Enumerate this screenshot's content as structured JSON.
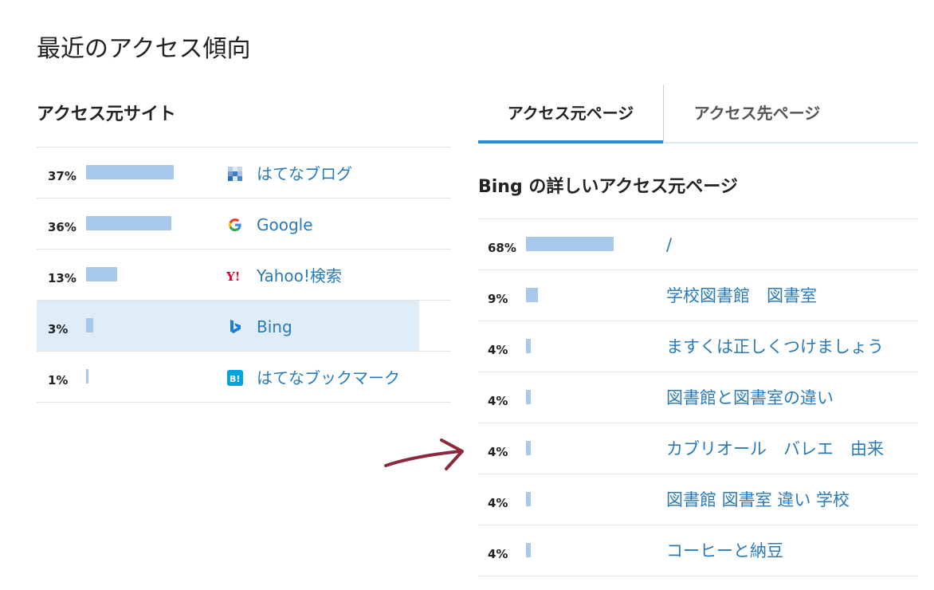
{
  "page": {
    "title": "最近のアクセス傾向"
  },
  "referrers": {
    "heading": "アクセス元サイト",
    "rows": [
      {
        "percent": "37%",
        "share": 0.37,
        "name": "はてなブログ",
        "icon": "hatena-blog-icon"
      },
      {
        "percent": "36%",
        "share": 0.36,
        "name": "Google",
        "icon": "google-icon"
      },
      {
        "percent": "13%",
        "share": 0.13,
        "name": "Yahoo!検索",
        "icon": "yahoo-icon"
      },
      {
        "percent": "3%",
        "share": 0.03,
        "name": "Bing",
        "icon": "bing-icon",
        "selected": true
      },
      {
        "percent": "1%",
        "share": 0.01,
        "name": "はてなブックマーク",
        "icon": "hatena-bookmark-icon"
      }
    ]
  },
  "detail": {
    "tabs": [
      {
        "label": "アクセス元ページ",
        "active": true
      },
      {
        "label": "アクセス先ページ",
        "active": false
      }
    ],
    "heading": "Bing の詳しいアクセス元ページ",
    "rows": [
      {
        "percent": "68%",
        "share": 0.68,
        "page": "/"
      },
      {
        "percent": "9%",
        "share": 0.09,
        "page": "学校図書館　図書室"
      },
      {
        "percent": "4%",
        "share": 0.04,
        "page": "ますくは正しくつけましょう"
      },
      {
        "percent": "4%",
        "share": 0.04,
        "page": "図書館と図書室の違い"
      },
      {
        "percent": "4%",
        "share": 0.04,
        "page": "カブリオール　バレエ　由来"
      },
      {
        "percent": "4%",
        "share": 0.04,
        "page": "図書館 図書室 違い 学校"
      },
      {
        "percent": "4%",
        "share": 0.04,
        "page": "コーヒーと納豆"
      }
    ]
  },
  "colors": {
    "link": "#2a7ab7",
    "bar": "#a9c9ea",
    "selected_row": "#deedf7",
    "active_tab_underline": "#2f8dd8",
    "annotation_arrow": "#8b2a3c"
  }
}
